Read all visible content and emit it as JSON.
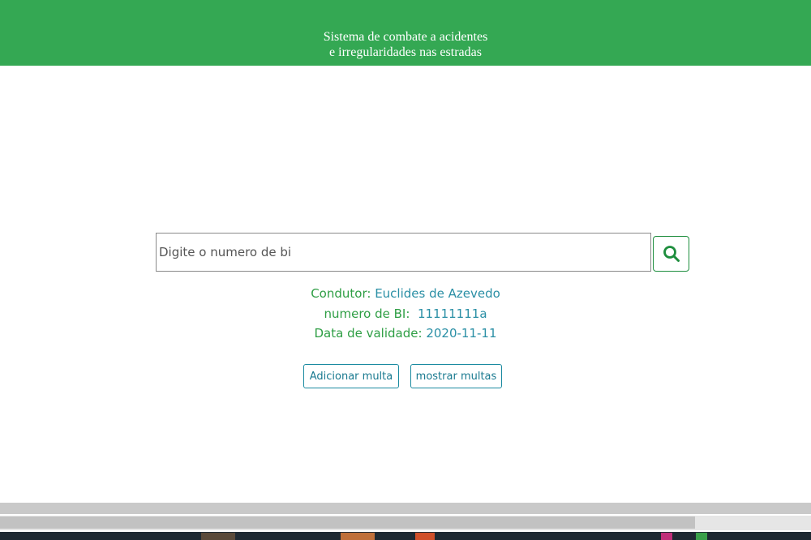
{
  "header": {
    "title_line1": "Sistema de combate a acidentes",
    "title_line2": "e irregularidades nas estradas",
    "bg_color": "#34a853"
  },
  "search": {
    "placeholder": "Digite o numero de bi",
    "value": "",
    "button_icon": "search-icon"
  },
  "driver": {
    "name_label": "Condutor:",
    "name_value": "Euclides de Azevedo",
    "bi_label": "numero de BI:",
    "bi_value": "11111111a",
    "validity_label": "Data de validade:",
    "validity_value": "2020-11-11"
  },
  "actions": {
    "add_fine": "Adicionar multa",
    "show_fines": "mostrar multas"
  },
  "colors": {
    "label_green": "#2e9e44",
    "value_blue": "#2a8fa5"
  }
}
